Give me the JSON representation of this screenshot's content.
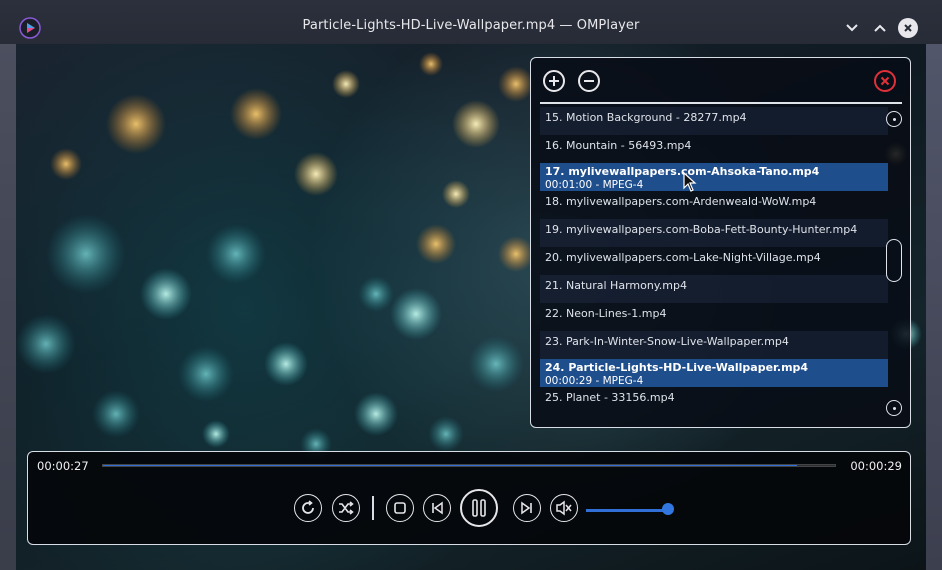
{
  "window": {
    "title": "Particle-Lights-HD-Live-Wallpaper.mp4 — OMPlayer",
    "icons": {
      "app": "omplayer-logo-icon",
      "minimize": "chevron-down-icon",
      "maximize": "chevron-up-icon",
      "close": "close-icon"
    }
  },
  "playlist": {
    "toolbar": {
      "add_icon": "plus-icon",
      "remove_icon": "minus-icon",
      "close_icon": "close-icon"
    },
    "items": [
      {
        "label": "15. Motion Background - 28277.mp4",
        "active": false,
        "detail": ""
      },
      {
        "label": "16. Mountain - 56493.mp4",
        "active": false,
        "detail": ""
      },
      {
        "label": "17. mylivewallpapers.com-Ahsoka-Tano.mp4",
        "active": true,
        "detail": "00:01:00 - MPEG-4"
      },
      {
        "label": "18. mylivewallpapers.com-Ardenweald-WoW.mp4",
        "active": false,
        "detail": ""
      },
      {
        "label": "19. mylivewallpapers.com-Boba-Fett-Bounty-Hunter.mp4",
        "active": false,
        "detail": ""
      },
      {
        "label": "20. mylivewallpapers.com-Lake-Night-Village.mp4",
        "active": false,
        "detail": ""
      },
      {
        "label": "21. Natural Harmony.mp4",
        "active": false,
        "detail": ""
      },
      {
        "label": "22. Neon-Lines-1.mp4",
        "active": false,
        "detail": ""
      },
      {
        "label": "23. Park-In-Winter-Snow-Live-Wallpaper.mp4",
        "active": false,
        "detail": ""
      },
      {
        "label": "24. Particle-Lights-HD-Live-Wallpaper.mp4",
        "active": true,
        "detail": "00:00:29 - MPEG-4"
      },
      {
        "label": "25. Planet - 33156.mp4",
        "active": false,
        "detail": ""
      }
    ]
  },
  "player": {
    "current_time": "00:00:27",
    "total_time": "00:00:29",
    "progress": 0.948,
    "volume": 1.0,
    "buttons": [
      "repeat-icon",
      "shuffle-icon",
      "stop-icon",
      "previous-icon",
      "pause-icon",
      "next-icon",
      "mute-icon"
    ]
  },
  "colors": {
    "accent": "#2f6fd6",
    "selection": "#1f4e8c",
    "close_red": "#e0303a"
  }
}
